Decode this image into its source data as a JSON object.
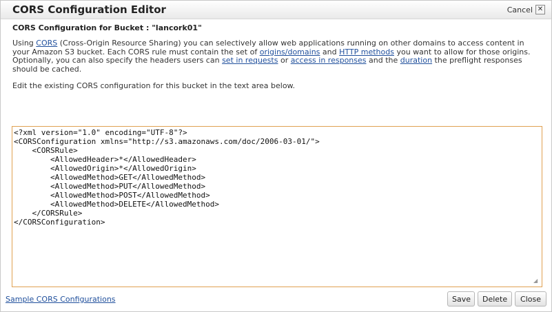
{
  "dialog": {
    "title": "CORS Configuration Editor",
    "cancel_label": "Cancel",
    "close_glyph": "✕",
    "subtitle": "CORS Configuration for Bucket : \"lancork01\""
  },
  "description": {
    "t1": "Using ",
    "link_cors": "CORS",
    "t2": " (Cross-Origin Resource Sharing) you can selectively allow web applications running on other domains to access content in your Amazon S3 bucket. Each CORS rule must contain the set of ",
    "link_origins": "origins/domains",
    "t3": " and ",
    "link_http_methods": "HTTP methods",
    "t4": " you want to allow for those origins. Optionally, you can also specify the headers users can ",
    "link_set_in_requests": "set in requests",
    "t5": " or ",
    "link_access_in_responses": "access in responses",
    "t6": " and the ",
    "link_duration": "duration",
    "t7": " the preflight responses should be cached."
  },
  "instruction": "Edit the existing CORS configuration for this bucket in the text area below.",
  "editor": {
    "value": "<?xml version=\"1.0\" encoding=\"UTF-8\"?>\n<CORSConfiguration xmlns=\"http://s3.amazonaws.com/doc/2006-03-01/\">\n    <CORSRule>\n        <AllowedHeader>*</AllowedHeader>\n        <AllowedOrigin>*</AllowedOrigin>\n        <AllowedMethod>GET</AllowedMethod>\n        <AllowedMethod>PUT</AllowedMethod>\n        <AllowedMethod>POST</AllowedMethod>\n        <AllowedMethod>DELETE</AllowedMethod>\n    </CORSRule>\n</CORSConfiguration>"
  },
  "footer": {
    "sample_link": "Sample CORS Configurations",
    "save_label": "Save",
    "delete_label": "Delete",
    "close_label": "Close"
  },
  "colors": {
    "link": "#1f4f9c",
    "editor_border": "#e0a050"
  },
  "icons": {
    "close": "close-icon",
    "resize": "resize-grip-icon"
  }
}
